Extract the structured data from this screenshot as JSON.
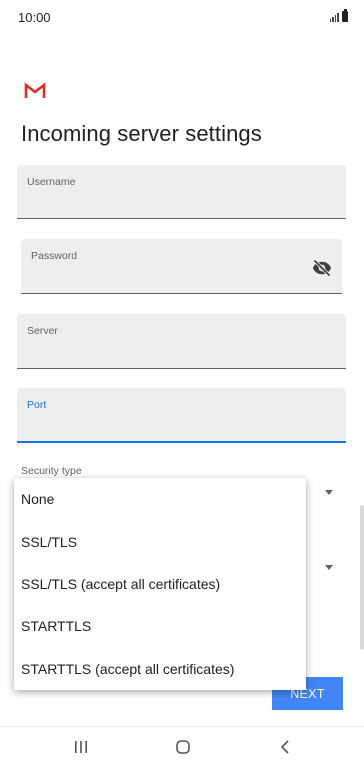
{
  "status_bar": {
    "time": "10:00"
  },
  "header": {
    "logo_icon": "gmail-m-icon",
    "title": "Incoming server settings"
  },
  "form": {
    "username": {
      "label": "Username",
      "value": ""
    },
    "password": {
      "label": "Password",
      "value": "",
      "toggle_icon": "visibility-off-icon"
    },
    "server": {
      "label": "Server",
      "value": ""
    },
    "port": {
      "label": "Port",
      "value": ""
    },
    "security_type": {
      "label": "Security type"
    }
  },
  "dropdown": {
    "options": [
      "None",
      "SSL/TLS",
      "SSL/TLS (accept all certificates)",
      "STARTTLS",
      "STARTTLS (accept all certificates)"
    ]
  },
  "footer": {
    "next_label": "NEXT"
  },
  "nav_bar": {
    "icons": [
      "recent-apps-icon",
      "home-icon",
      "back-icon"
    ]
  },
  "colors": {
    "accent": "#1a73e8",
    "button": "#4285f4",
    "gmail_red": "#d93025",
    "field_bg": "#eeeeee"
  }
}
